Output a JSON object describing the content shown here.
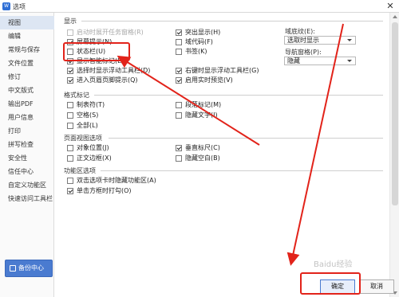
{
  "window": {
    "title": "选项",
    "app_icon": "W",
    "close_symbol": "✕"
  },
  "sidebar": {
    "items": [
      {
        "label": "视图",
        "active": true
      },
      {
        "label": "编辑"
      },
      {
        "label": "常规与保存"
      },
      {
        "label": "文件位置"
      },
      {
        "label": "修订"
      },
      {
        "label": "中文版式"
      },
      {
        "label": "输出PDF"
      },
      {
        "label": "用户信息"
      },
      {
        "label": "打印"
      },
      {
        "label": "拼写检查"
      },
      {
        "label": "安全性"
      },
      {
        "label": "信任中心"
      },
      {
        "label": "自定义功能区"
      },
      {
        "label": "快速访问工具栏"
      }
    ],
    "backup_label": "备份中心"
  },
  "sections": {
    "display": {
      "title": "显示",
      "left": [
        {
          "label": "启动时展开任务窗格(R)",
          "checked": false,
          "disabled": true
        },
        {
          "label": "屏幕提示(N)",
          "checked": true
        },
        {
          "label": "状态栏(U)",
          "checked": false
        },
        {
          "label": "显示智能标记(E)",
          "checked": true
        },
        {
          "label": "选择时显示浮动工具栏(D)",
          "checked": true
        },
        {
          "label": "进入页眉页脚提示(Q)",
          "checked": true
        }
      ],
      "right": [
        {
          "label": "突出显示(H)",
          "checked": true
        },
        {
          "label": "域代码(F)",
          "checked": false
        },
        {
          "label": "书签(K)",
          "checked": false
        },
        {
          "label": "右键时显示浮动工具栏(G)",
          "checked": true
        },
        {
          "label": "启用实时预览(V)",
          "checked": true
        }
      ],
      "field_shading": {
        "label": "域底纹(E):",
        "value": "选取时显示"
      },
      "nav_pane": {
        "label": "导航窗格(P):",
        "value": "隐藏"
      }
    },
    "format_marks": {
      "title": "格式标记",
      "left": [
        {
          "label": "制表符(T)",
          "checked": false
        },
        {
          "label": "空格(S)",
          "checked": false
        },
        {
          "label": "全部(L)",
          "checked": false
        }
      ],
      "right": [
        {
          "label": "段落标记(M)",
          "checked": false
        },
        {
          "label": "隐藏文字(I)",
          "checked": false
        }
      ]
    },
    "page_view": {
      "title": "页面视图选项",
      "left": [
        {
          "label": "对象位置(J)",
          "checked": false
        },
        {
          "label": "正文边框(X)",
          "checked": false
        }
      ],
      "right": [
        {
          "label": "垂直标尺(C)",
          "checked": true
        },
        {
          "label": "隐藏空白(B)",
          "checked": false
        }
      ]
    },
    "ribbon": {
      "title": "功能区选项",
      "items": [
        {
          "label": "双击选项卡时隐藏功能区(A)",
          "checked": false
        },
        {
          "label": "单击方框时打勾(O)",
          "checked": true
        }
      ]
    }
  },
  "buttons": {
    "ok": "确定",
    "cancel": "取消"
  },
  "watermark": "Baidu经验",
  "annotation_color": "#e2231a"
}
